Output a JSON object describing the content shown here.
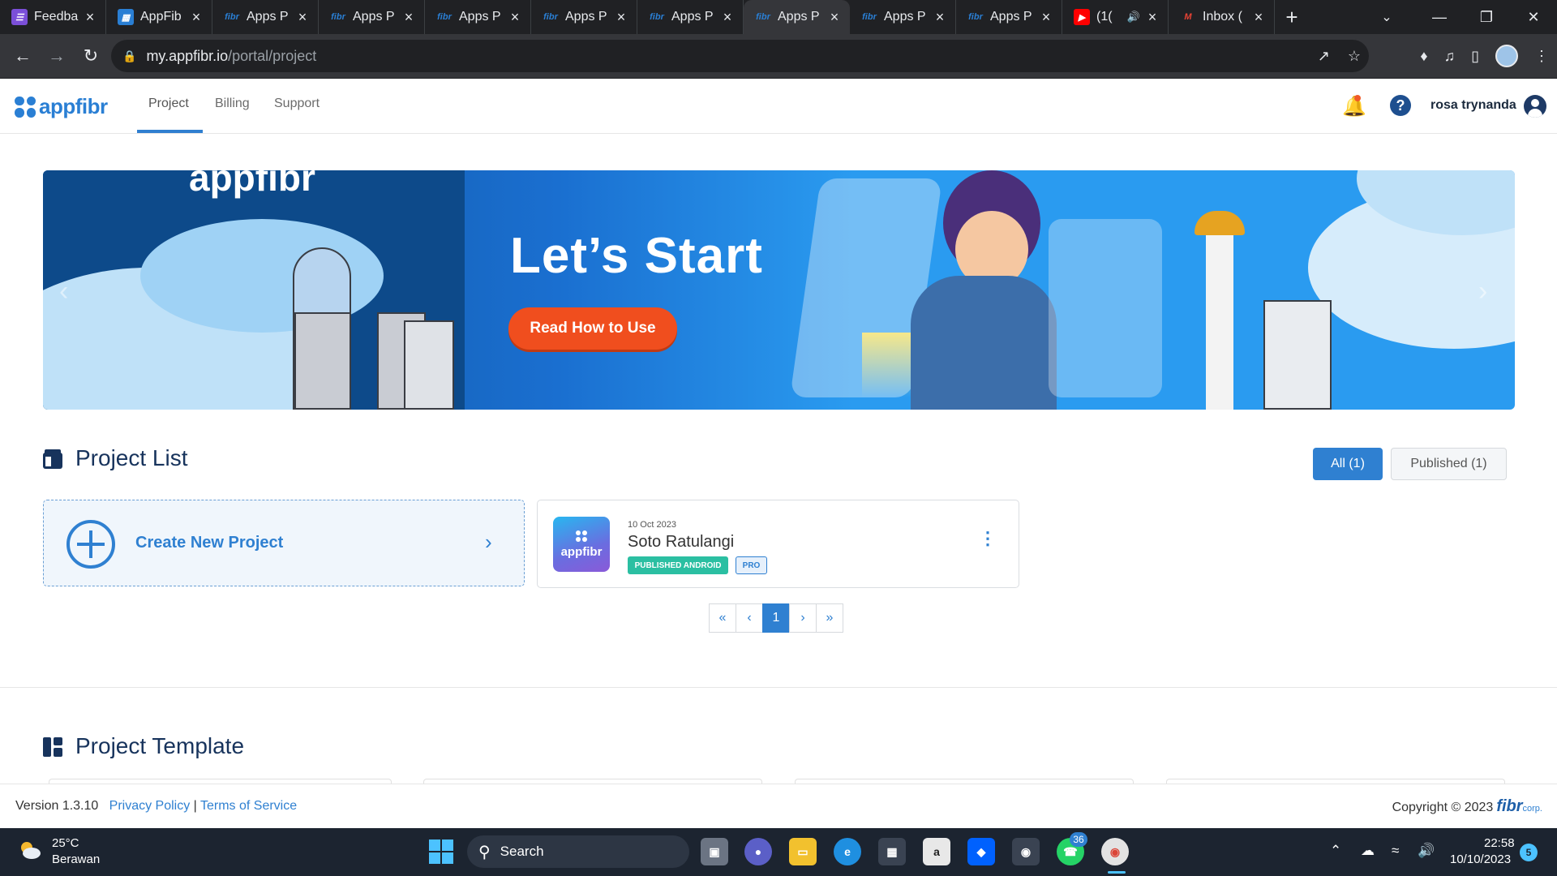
{
  "browser": {
    "tabs": [
      {
        "title": "Feedba",
        "favicon": "feedback-form-icon",
        "active": false
      },
      {
        "title": "AppFib",
        "favicon": "appfibr-grid-icon",
        "active": false
      },
      {
        "title": "Apps P",
        "favicon": "fibr-icon",
        "active": false
      },
      {
        "title": "Apps P",
        "favicon": "fibr-icon",
        "active": false
      },
      {
        "title": "Apps P",
        "favicon": "fibr-icon",
        "active": false
      },
      {
        "title": "Apps P",
        "favicon": "fibr-icon",
        "active": false
      },
      {
        "title": "Apps P",
        "favicon": "fibr-icon",
        "active": false
      },
      {
        "title": "Apps P",
        "favicon": "fibr-icon",
        "active": true
      },
      {
        "title": "Apps P",
        "favicon": "fibr-icon",
        "active": false
      },
      {
        "title": "Apps P",
        "favicon": "fibr-icon",
        "active": false
      },
      {
        "title": "(1(",
        "favicon": "youtube-icon",
        "active": false
      },
      {
        "title": "Inbox (",
        "favicon": "gmail-icon",
        "active": false
      }
    ],
    "favicon_text": "fibr",
    "url_host": "my.appfibr.io",
    "url_path": "/portal/project"
  },
  "header": {
    "logo_text": "appfibr",
    "nav": [
      "Project",
      "Billing",
      "Support"
    ],
    "active_nav": "Project",
    "user_name": "rosa trynanda"
  },
  "banner": {
    "brand_text": "appfibr",
    "title": "Let’s Start",
    "button_label": "Read How to Use"
  },
  "project_list": {
    "title": "Project List",
    "filters": {
      "all": "All (1)",
      "published": "Published (1)"
    },
    "create_label": "Create New Project",
    "projects": [
      {
        "date": "10 Oct 2023",
        "name": "Soto Ratulangi",
        "logo_text": "appfibr",
        "status_badge": "PUBLISHED ANDROID",
        "plan_badge": "PRO"
      }
    ],
    "pagination": {
      "current_page": "1"
    }
  },
  "project_template": {
    "title": "Project Template"
  },
  "footer": {
    "version": "Version 1.3.10",
    "privacy": "Privacy Policy",
    "separator": "|",
    "terms": "Terms of Service",
    "copyright": "Copyright © 2023",
    "brand": "fibr",
    "brand_suffix": "corp."
  },
  "taskbar": {
    "weather_temp": "25°C",
    "weather_desc": "Berawan",
    "search_label": "Search",
    "whatsapp_badge": "36",
    "time": "22:58",
    "date": "10/10/2023",
    "notification_count": "5"
  },
  "colors": {
    "accent": "#2f80d1",
    "brand": "#2a7fd4",
    "heading": "#17335c",
    "banner_button": "#f04e1e",
    "published_badge": "#2bbfa2"
  }
}
